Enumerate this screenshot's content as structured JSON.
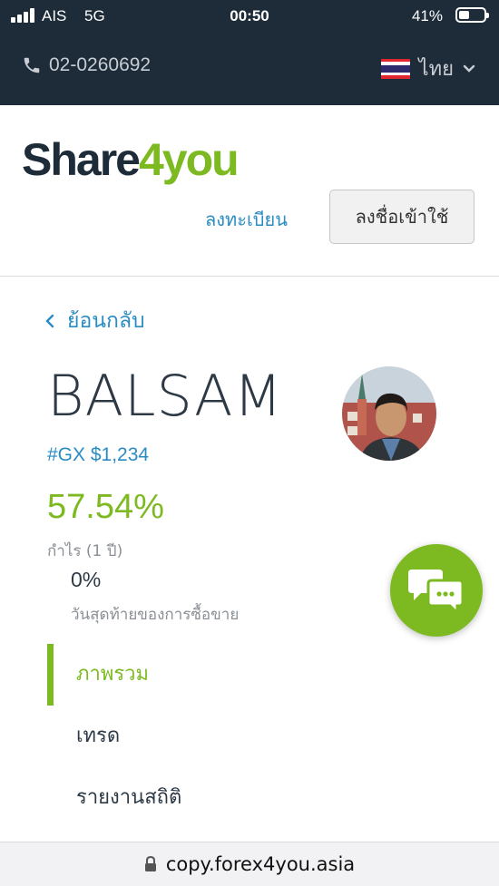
{
  "status_bar": {
    "carrier": "AIS",
    "network": "5G",
    "time": "00:50",
    "battery_percent": "41%"
  },
  "topbar": {
    "phone": "02-0260692",
    "language": "ไทย",
    "flag": "thailand-flag-icon"
  },
  "header": {
    "logo_part1": "Share",
    "logo_part2": "4you",
    "register_label": "ลงทะเบียน",
    "login_label": "ลงชื่อเข้าใช้"
  },
  "profile": {
    "back_label": "ย้อนกลับ",
    "name": "BALSAM",
    "gx_line": "#GX $1,234",
    "profit_value": "57.54%",
    "profit_label": "กำไร (1 ปี)",
    "last_trade_value": "0%",
    "last_trade_label": "วันสุดท้ายของการซื้อขาย"
  },
  "tabs": [
    {
      "label": "ภาพรวม",
      "active": true
    },
    {
      "label": "เทรด",
      "active": false
    },
    {
      "label": "รายงานสถิติ",
      "active": false
    }
  ],
  "url_bar": {
    "url": "copy.forex4you.asia"
  },
  "colors": {
    "brand_green": "#7dba22",
    "brand_dark": "#1e2c3a",
    "link_blue": "#2a8cc4"
  }
}
